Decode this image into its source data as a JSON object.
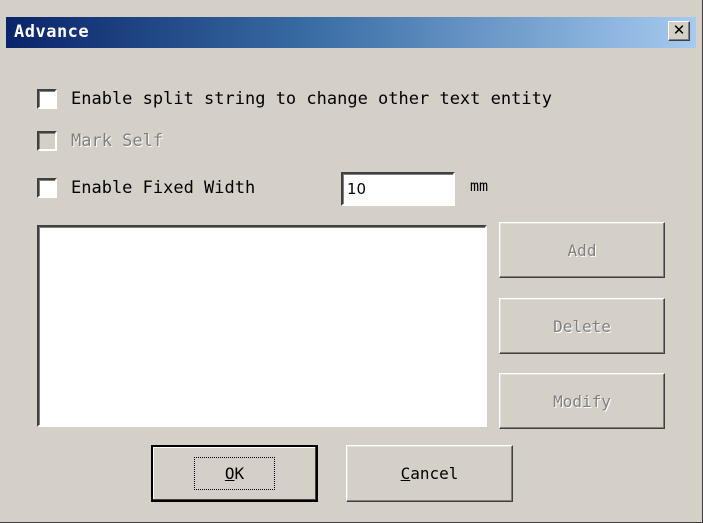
{
  "window": {
    "title": "Advance",
    "close_label": "✕"
  },
  "options": {
    "split_string": {
      "label": "Enable split string to change other text entity",
      "checked": false
    },
    "mark_self": {
      "label": "Mark Self",
      "checked": false,
      "enabled": false
    },
    "fixed_width": {
      "label": "Enable Fixed Width",
      "checked": false,
      "value": "10",
      "unit": "mm"
    }
  },
  "buttons": {
    "add": "Add",
    "delete": "Delete",
    "modify": "Modify",
    "ok": {
      "mnemonic": "O",
      "rest": "K"
    },
    "cancel": {
      "mnemonic": "C",
      "rest": "ancel"
    }
  },
  "colors": {
    "face": "#d4d0c8",
    "title_start": "#0a246a",
    "title_end": "#a6caf0",
    "disabled_text": "#808080"
  }
}
